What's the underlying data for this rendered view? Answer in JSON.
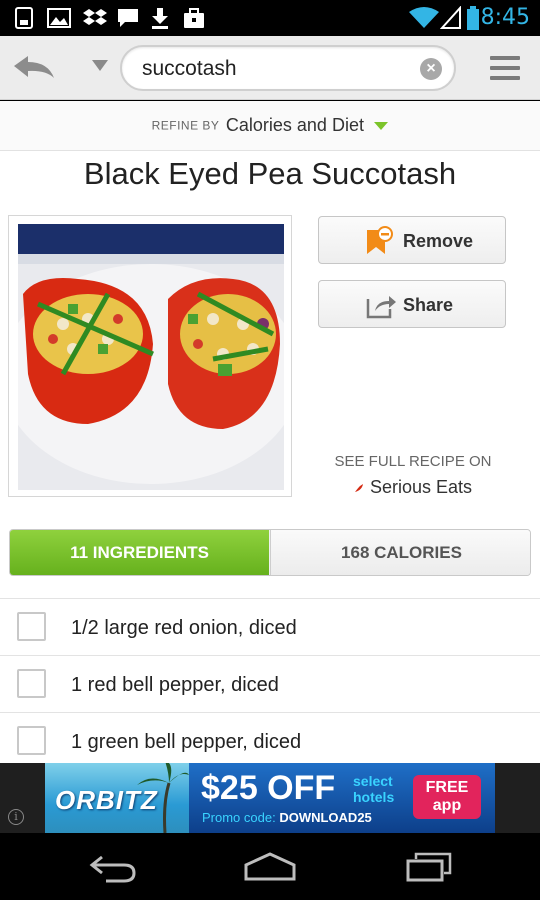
{
  "status_bar": {
    "time": "8:45",
    "notification_icons": [
      "screenshot-icon",
      "image-icon",
      "dropbox-icon",
      "chat-icon",
      "download-icon",
      "briefcase-icon"
    ],
    "system_icons": [
      "wifi-icon",
      "signal-icon",
      "battery-icon"
    ]
  },
  "app_bar": {
    "search": {
      "value": "succotash"
    }
  },
  "refine": {
    "label": "REFINE BY",
    "value": "Calories and Diet"
  },
  "recipe": {
    "title": "Black Eyed Pea Succotash",
    "actions": {
      "remove_label": "Remove",
      "share_label": "Share"
    },
    "see_full_label": "SEE FULL RECIPE ON",
    "source_name": "Serious Eats"
  },
  "tabs": [
    {
      "label": "11 INGREDIENTS",
      "active": true
    },
    {
      "label": "168 CALORIES",
      "active": false
    }
  ],
  "ingredients": [
    {
      "text": "1/2 large red onion, diced",
      "checked": false
    },
    {
      "text": "1 red bell pepper, diced",
      "checked": false
    },
    {
      "text": "1 green bell pepper, diced",
      "checked": false
    }
  ],
  "ad": {
    "brand": "ORBITZ",
    "offer": "$25 OFF",
    "offer_line1": "select",
    "offer_line2": "hotels",
    "promo_label": "Promo code:",
    "promo_code": "DOWNLOAD25",
    "cta_line1": "FREE",
    "cta_line2": "app",
    "info": "i"
  },
  "colors": {
    "accent_green": "#7cc42a",
    "status_time": "#33b5e5",
    "ad_cta": "#e2245c"
  }
}
